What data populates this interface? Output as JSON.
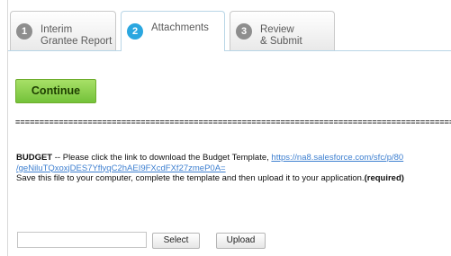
{
  "tabs": [
    {
      "number": "1",
      "label": "Interim\nGrantee Report",
      "active": false
    },
    {
      "number": "2",
      "label": "Attachments",
      "active": true
    },
    {
      "number": "3",
      "label": "Review\n& Submit",
      "active": false
    }
  ],
  "continue_label": "Continue",
  "separator_text": "==============================================================================================================================",
  "budget": {
    "heading": "BUDGET",
    "instruction": " -- Please click the link to download the Budget Template, ",
    "link_part1": "https://na8.salesforce.com/sfc/p/80",
    "link_part2": "/geNiluTQxoxjDES7YflyqC2hAEI9FXcdFXf27zmeP0A=",
    "save_text": "Save this file to your computer, complete the template and then upload it to your application.",
    "required_text": "(required)"
  },
  "upload": {
    "file_value": "",
    "select_label": "Select",
    "upload_label": "Upload"
  },
  "colors": {
    "active_tab_number": "#2aa7e0",
    "inactive_tab_number": "#8e8e8e",
    "continue_button": "#7cc43f",
    "link": "#3d7fd0"
  }
}
